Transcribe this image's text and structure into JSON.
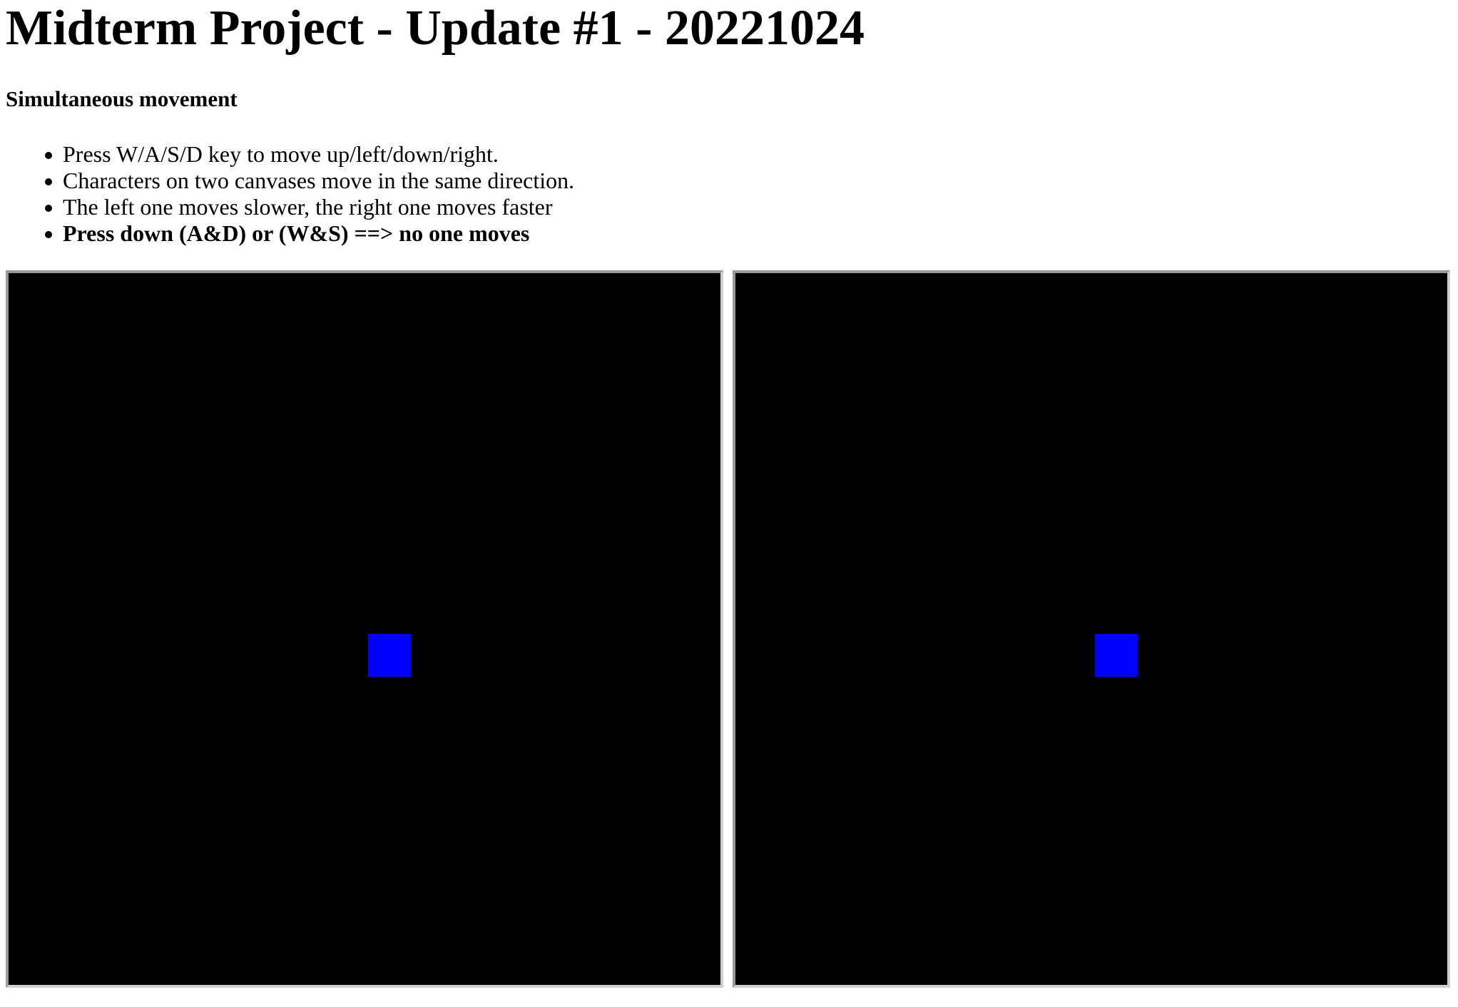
{
  "page": {
    "title": "Midterm Project - Update #1 - 20221024",
    "section_title": "Simultaneous movement"
  },
  "instructions": [
    "Press W/A/S/D key to move up/left/down/right.",
    "Characters on two canvases move in the same direction.",
    "The left one moves slower, the right one moves faster",
    "Press down (A&D) or (W&S) ==> no one moves"
  ],
  "canvases": [
    {
      "name": "left",
      "speed": "slower",
      "background_color": "#000000",
      "player_color": "#0000ff"
    },
    {
      "name": "right",
      "speed": "faster",
      "background_color": "#000000",
      "player_color": "#0000ff"
    }
  ]
}
